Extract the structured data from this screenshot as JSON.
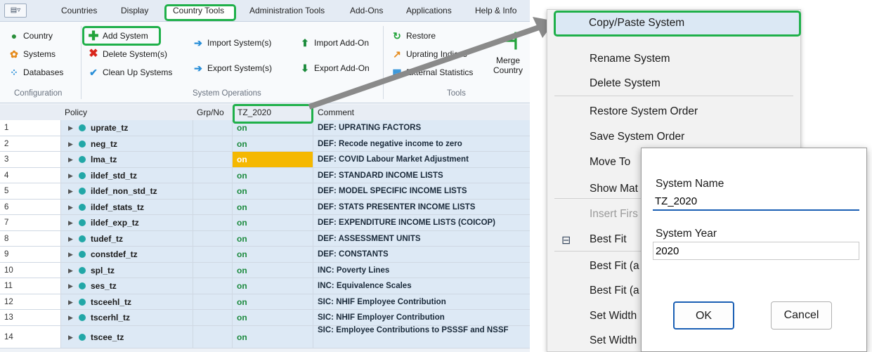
{
  "menubar": {
    "tabs": [
      "Countries",
      "Display",
      "Country Tools",
      "Administration Tools",
      "Add-Ons",
      "Applications",
      "Help & Info"
    ]
  },
  "ribbon": {
    "configuration": {
      "country": "Country",
      "systems": "Systems",
      "databases": "Databases",
      "label": "Configuration"
    },
    "system_operations": {
      "add_system": "Add System",
      "delete_systems": "Delete System(s)",
      "clean_up": "Clean Up Systems",
      "import_systems": "Import System(s)",
      "export_systems": "Export System(s)",
      "import_addon": "Import Add-On",
      "export_addon": "Export Add-On",
      "label": "System Operations"
    },
    "tools": {
      "restore": "Restore",
      "uprating": "Uprating Indices",
      "external": "External Statistics",
      "merge1": "Merge",
      "merge2": "Country",
      "label": "Tools"
    }
  },
  "grid": {
    "headers": {
      "policy": "Policy",
      "grp": "Grp/No",
      "system": "TZ_2020",
      "comment": "Comment"
    },
    "rows": [
      {
        "num": "1",
        "name": "uprate_tz",
        "value": "on",
        "comment": "DEF: UPRATING FACTORS"
      },
      {
        "num": "2",
        "name": "neg_tz",
        "value": "on",
        "comment": "DEF: Recode negative income to zero"
      },
      {
        "num": "3",
        "name": "lma_tz",
        "value": "on",
        "comment": "DEF: COVID Labour Market Adjustment"
      },
      {
        "num": "4",
        "name": "ildef_std_tz",
        "value": "on",
        "comment": "DEF: STANDARD INCOME LISTS"
      },
      {
        "num": "5",
        "name": "ildef_non_std_tz",
        "value": "on",
        "comment": "DEF: MODEL SPECIFIC INCOME LISTS"
      },
      {
        "num": "6",
        "name": "ildef_stats_tz",
        "value": "on",
        "comment": "DEF: STATS PRESENTER INCOME LISTS"
      },
      {
        "num": "7",
        "name": "ildef_exp_tz",
        "value": "on",
        "comment": "DEF: EXPENDITURE INCOME LISTS (COICOP)"
      },
      {
        "num": "8",
        "name": "tudef_tz",
        "value": "on",
        "comment": "DEF: ASSESSMENT UNITS"
      },
      {
        "num": "9",
        "name": "constdef_tz",
        "value": "on",
        "comment": "DEF: CONSTANTS"
      },
      {
        "num": "10",
        "name": "spl_tz",
        "value": "on",
        "comment": "INC: Poverty Lines"
      },
      {
        "num": "11",
        "name": "ses_tz",
        "value": "on",
        "comment": "INC: Equivalence Scales"
      },
      {
        "num": "12",
        "name": "tsceehl_tz",
        "value": "on",
        "comment": "SIC: NHIF Employee Contribution"
      },
      {
        "num": "13",
        "name": "tscerhl_tz",
        "value": "on",
        "comment": "SIC: NHIF Employer Contribution"
      },
      {
        "num": "14",
        "name": "tscee_tz",
        "value": "on",
        "comment": "SIC: Employee Contributions to PSSSF and NSSF"
      }
    ]
  },
  "context_menu": {
    "copy_paste": "Copy/Paste System",
    "rename": "Rename System",
    "delete": "Delete System",
    "restore_order": "Restore System Order",
    "save_order": "Save System Order",
    "move_to": "Move To",
    "show_mat": "Show Mat",
    "insert_first": "Insert Firs",
    "best_fit": "Best Fit",
    "best_fit_a1": "Best Fit (a",
    "best_fit_a2": "Best Fit (a",
    "set_width1": "Set Width",
    "set_width2": "Set Width"
  },
  "dialog": {
    "name_label": "System Name",
    "name_value": "TZ_2020",
    "year_label": "System Year",
    "year_value": "2020",
    "ok": "OK",
    "cancel": "Cancel"
  }
}
